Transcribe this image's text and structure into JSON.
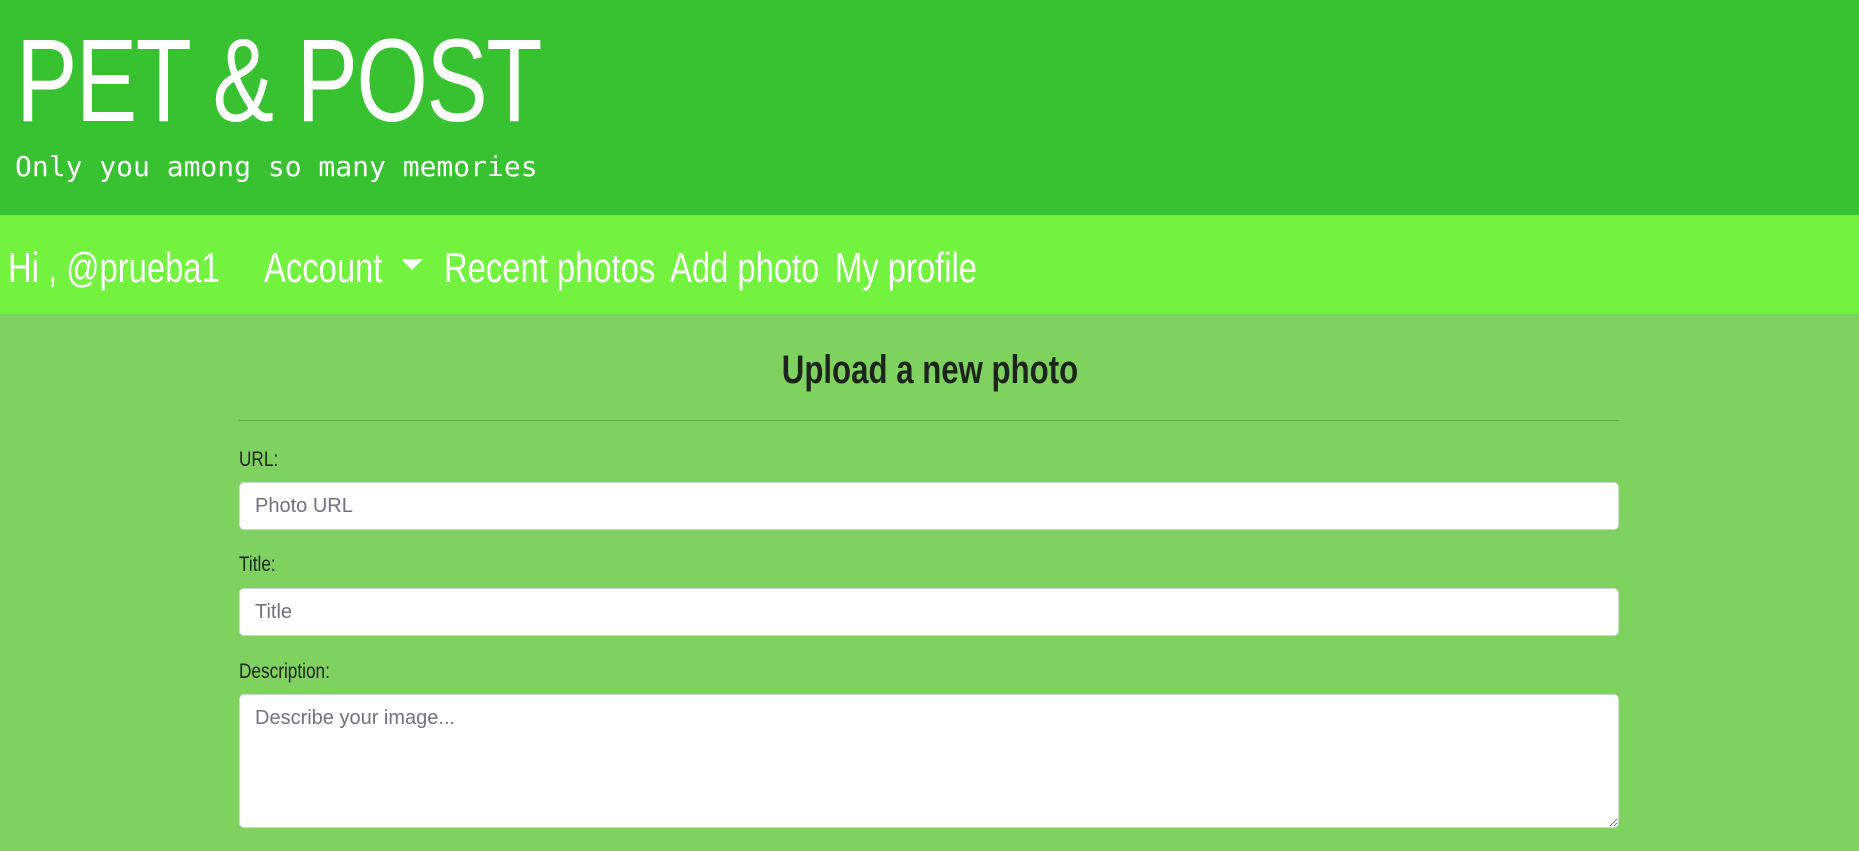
{
  "header": {
    "title": "PET & POST",
    "tagline": "Only you among so many memories"
  },
  "nav": {
    "greeting": "Hi , @prueba1",
    "account": "Account",
    "recent_photos": "Recent photos",
    "add_photo": "Add photo",
    "my_profile": "My profile"
  },
  "form": {
    "heading": "Upload a new photo",
    "url_label": "URL:",
    "url_placeholder": "Photo URL",
    "title_label": "Title:",
    "title_placeholder": "Title",
    "description_label": "Description:",
    "description_placeholder": "Describe your image..."
  },
  "colors": {
    "header_bg": "#38c130",
    "navbar_bg": "#73f240",
    "page_bg": "#80d260"
  },
  "icons": {
    "account_dropdown": "caret-down-icon"
  }
}
